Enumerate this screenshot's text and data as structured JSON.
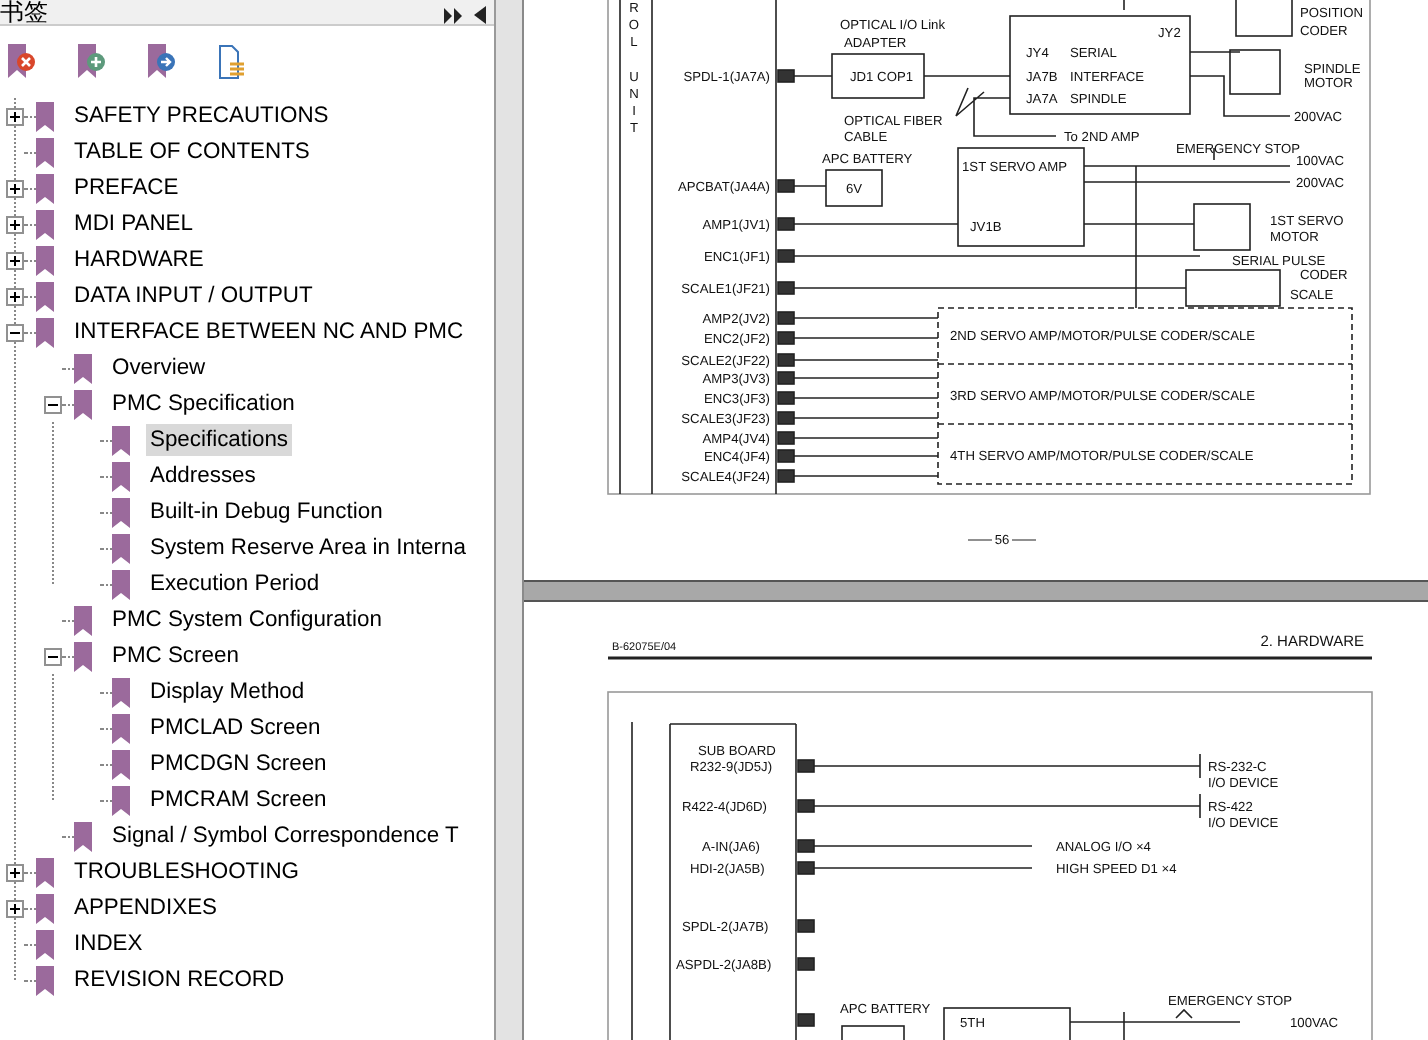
{
  "panel": {
    "title": "书签"
  },
  "toolbar": [
    {
      "kind": "delete"
    },
    {
      "kind": "add"
    },
    {
      "kind": "goto"
    },
    {
      "kind": "options"
    }
  ],
  "bookmarks": [
    {
      "label": "SAFETY PRECAUTIONS",
      "expanded": false,
      "selected": false
    },
    {
      "label": "TABLE OF CONTENTS",
      "selected": false
    },
    {
      "label": "PREFACE",
      "expanded": false,
      "selected": false
    },
    {
      "label": "MDI PANEL",
      "expanded": false,
      "selected": false
    },
    {
      "label": "HARDWARE",
      "expanded": false,
      "selected": false
    },
    {
      "label": "DATA INPUT / OUTPUT",
      "expanded": false,
      "selected": false
    },
    {
      "label": "INTERFACE BETWEEN NC AND PMC",
      "expanded": true,
      "selected": false,
      "children": [
        {
          "label": "Overview",
          "selected": false
        },
        {
          "label": "PMC Specification",
          "expanded": true,
          "selected": false,
          "children": [
            {
              "label": "Specifications",
              "selected": true
            },
            {
              "label": "Addresses",
              "selected": false
            },
            {
              "label": "Built-in Debug Function",
              "selected": false
            },
            {
              "label": "System Reserve Area in Interna",
              "selected": false
            },
            {
              "label": "Execution Period",
              "selected": false
            }
          ]
        },
        {
          "label": "PMC System Configuration",
          "selected": false
        },
        {
          "label": "PMC Screen",
          "expanded": true,
          "selected": false,
          "children": [
            {
              "label": "Display Method",
              "selected": false
            },
            {
              "label": "PMCLAD Screen",
              "selected": false
            },
            {
              "label": "PMCDGN Screen",
              "selected": false
            },
            {
              "label": "PMCRAM Screen",
              "selected": false
            }
          ]
        },
        {
          "label": "Signal / Symbol Correspondence T",
          "selected": false
        }
      ]
    },
    {
      "label": "TROUBLESHOOTING",
      "expanded": false,
      "selected": false
    },
    {
      "label": "APPENDIXES",
      "expanded": false,
      "selected": false
    },
    {
      "label": "INDEX",
      "selected": false
    },
    {
      "label": "REVISION RECORD",
      "selected": false
    }
  ],
  "page_1": {
    "side_label": "ROL UNIT",
    "labels": [
      "OPTICAL I/O Link",
      "ADAPTER",
      "SPDL-1(JA7A)",
      "JD1 COP1",
      "JY4",
      "SERIAL",
      "JA7B",
      "INTERFACE",
      "JA7A",
      "SPINDLE",
      "JY2",
      "POSITION",
      "CODER",
      "SPINDLE",
      "MOTOR",
      "200VAC",
      "OPTICAL FIBER",
      "CABLE",
      "To 2ND AMP",
      "APC BATTERY",
      "APCBAT(JA4A)",
      "6V",
      "1ST SERVO AMP",
      "EMERGENCY STOP",
      "100VAC",
      "200VAC",
      "AMP1(JV1)",
      "JV1B",
      "1ST SERVO",
      "MOTOR",
      "ENC1(JF1)",
      "SERIAL PULSE",
      "CODER",
      "SCALE1(JF21)",
      "SCALE",
      "AMP2(JV2)",
      "ENC2(JF2)",
      "SCALE2(JF22)",
      "AMP3(JV3)",
      "ENC3(JF3)",
      "SCALE3(JF23)",
      "AMP4(JV4)",
      "ENC4(JF4)",
      "SCALE4(JF24)"
    ],
    "unit_blocks": [
      "2ND SERVO AMP/MOTOR/PULSE CODER/SCALE",
      "3RD SERVO AMP/MOTOR/PULSE CODER/SCALE",
      "4TH SERVO AMP/MOTOR/PULSE CODER/SCALE"
    ],
    "page_number": "56"
  },
  "page_2": {
    "header_left": "B-62075E/04",
    "header_right": "2. HARDWARE",
    "labels": [
      "SUB BOARD",
      "R232-9(JD5J)",
      "R422-4(JD6D)",
      "A-IN(JA6)",
      "HDI-2(JA5B)",
      "SPDL-2(JA7B)",
      "ASPDL-2(JA8B)",
      "RS-232-C",
      "I/O DEVICE",
      "RS-422",
      "I/O DEVICE",
      "ANALOG I/O ×4",
      "HIGH SPEED D1 ×4",
      "APC BATTERY",
      "5TH",
      "EMERGENCY STOP",
      "100VAC"
    ]
  }
}
